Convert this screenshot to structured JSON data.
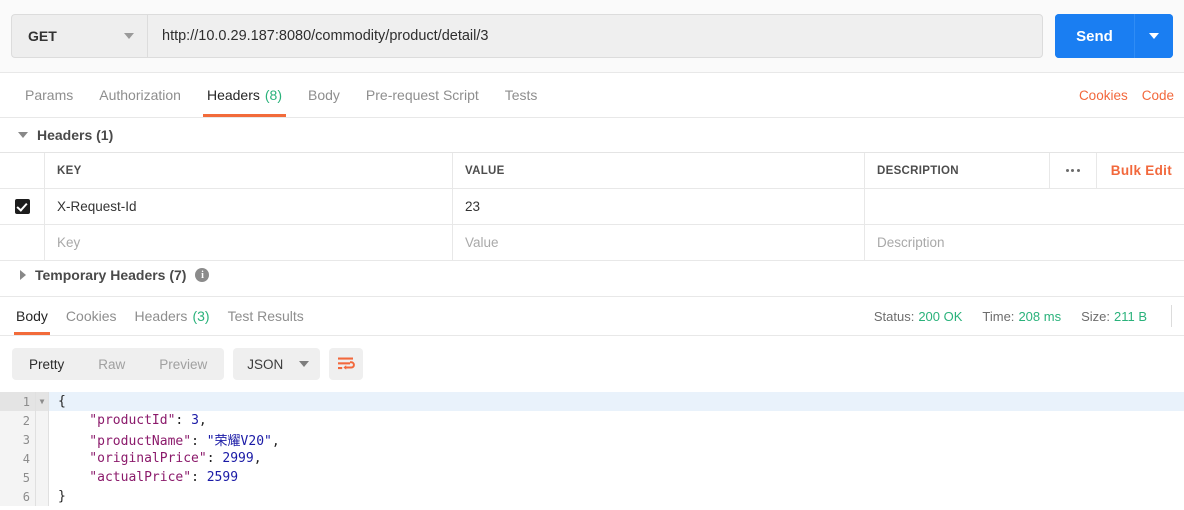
{
  "request_bar": {
    "method": "GET",
    "method_caret_icon": "chevron-down-icon",
    "url": "http://10.0.29.187:8080/commodity/product/detail/3",
    "url_placeholder": "Enter request URL",
    "send_label": "Send",
    "send_caret_icon": "chevron-down-icon",
    "accent_blue": "#1a7ef2"
  },
  "request_tabs": {
    "items": [
      {
        "label": "Params",
        "count": "",
        "active": false
      },
      {
        "label": "Authorization",
        "count": "",
        "active": false
      },
      {
        "label": "Headers",
        "count": "(8)",
        "active": true
      },
      {
        "label": "Body",
        "count": "",
        "active": false
      },
      {
        "label": "Pre-request Script",
        "count": "",
        "active": false
      },
      {
        "label": "Tests",
        "count": "",
        "active": false
      }
    ],
    "cookies_label": "Cookies",
    "code_label": "Code",
    "accent_orange": "#f26b3a",
    "count_green": "#2ab27b"
  },
  "headers_section": {
    "title": "Headers (1)",
    "toggle_icon": "triangle-down-icon",
    "columns": {
      "key": "KEY",
      "value": "VALUE",
      "description": "DESCRIPTION"
    },
    "more_icon": "ellipsis-icon",
    "bulk_edit_label": "Bulk Edit",
    "rows": [
      {
        "checked": true,
        "key": "X-Request-Id",
        "value": "23",
        "description": ""
      }
    ],
    "placeholder_row": {
      "key": "Key",
      "value": "Value",
      "description": "Description"
    }
  },
  "temporary_headers_section": {
    "title": "Temporary Headers (7)",
    "toggle_icon": "triangle-right-icon",
    "info_icon": "info-icon",
    "info_glyph": "i"
  },
  "response_tabs": {
    "items": [
      {
        "label": "Body",
        "count": "",
        "active": true
      },
      {
        "label": "Cookies",
        "count": "",
        "active": false
      },
      {
        "label": "Headers",
        "count": "(3)",
        "active": false
      },
      {
        "label": "Test Results",
        "count": "",
        "active": false
      }
    ],
    "status": {
      "status_label": "Status:",
      "status_value": "200 OK",
      "time_label": "Time:",
      "time_value": "208 ms",
      "size_label": "Size:",
      "size_value": "211 B",
      "value_color": "#2ab27b"
    }
  },
  "body_toolbar": {
    "view_modes": [
      {
        "label": "Pretty",
        "active": true
      },
      {
        "label": "Raw",
        "active": false
      },
      {
        "label": "Preview",
        "active": false
      }
    ],
    "format": "JSON",
    "format_caret_icon": "chevron-down-icon",
    "wrap_icon": "text-wrap-icon"
  },
  "response_body": {
    "lines": [
      {
        "num": "1",
        "foldable": true,
        "active": true,
        "tokens": [
          {
            "t": "{",
            "c": "p"
          }
        ]
      },
      {
        "num": "2",
        "foldable": false,
        "active": false,
        "tokens": [
          {
            "t": "    \"productId\"",
            "c": "k"
          },
          {
            "t": ": ",
            "c": "p"
          },
          {
            "t": "3",
            "c": "n"
          },
          {
            "t": ",",
            "c": "p"
          }
        ]
      },
      {
        "num": "3",
        "foldable": false,
        "active": false,
        "tokens": [
          {
            "t": "    \"productName\"",
            "c": "k"
          },
          {
            "t": ": ",
            "c": "p"
          },
          {
            "t": "\"荣耀V20\"",
            "c": "s"
          },
          {
            "t": ",",
            "c": "p"
          }
        ]
      },
      {
        "num": "4",
        "foldable": false,
        "active": false,
        "tokens": [
          {
            "t": "    \"originalPrice\"",
            "c": "k"
          },
          {
            "t": ": ",
            "c": "p"
          },
          {
            "t": "2999",
            "c": "n"
          },
          {
            "t": ",",
            "c": "p"
          }
        ]
      },
      {
        "num": "5",
        "foldable": false,
        "active": false,
        "tokens": [
          {
            "t": "    \"actualPrice\"",
            "c": "k"
          },
          {
            "t": ": ",
            "c": "p"
          },
          {
            "t": "2599",
            "c": "n"
          }
        ]
      },
      {
        "num": "6",
        "foldable": false,
        "active": false,
        "tokens": [
          {
            "t": "}",
            "c": "p"
          }
        ]
      }
    ]
  }
}
